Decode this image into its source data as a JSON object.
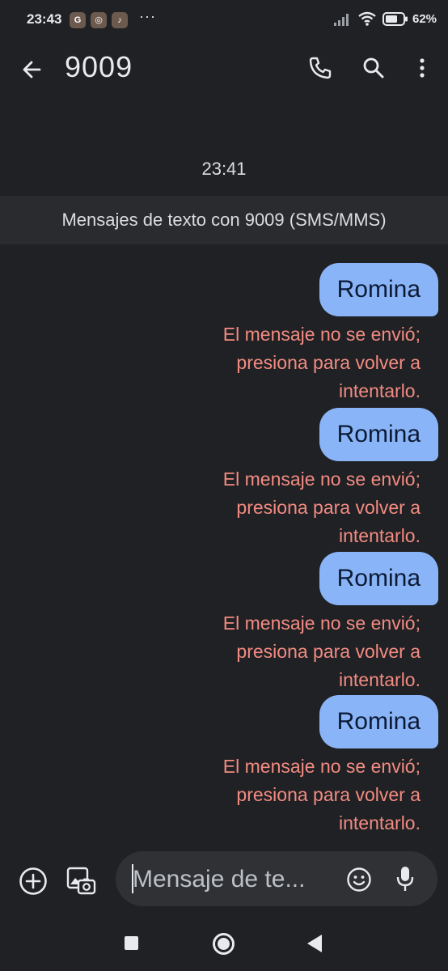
{
  "status_bar": {
    "time": "23:43",
    "app_icons": [
      {
        "name": "google-notification-icon",
        "glyph": "G"
      },
      {
        "name": "instagram-notification-icon",
        "glyph": "◎"
      },
      {
        "name": "tiktok-notification-icon",
        "glyph": "♪"
      }
    ],
    "more_indicator": "···",
    "battery_percent": "62%"
  },
  "app_bar": {
    "title": "9009",
    "icons": [
      "back-arrow-icon",
      "phone-icon",
      "search-icon",
      "more-vert-icon"
    ]
  },
  "conversation": {
    "timestamp": "23:41",
    "banner": "Mensajes de texto con 9009 (SMS/MMS)",
    "messages": [
      {
        "text": "Romina",
        "status_line1": "El mensaje no se envió;",
        "status_line2": "presiona para volver a",
        "status_line3": "intentarlo."
      },
      {
        "text": "Romina",
        "status_line1": "El mensaje no se envió;",
        "status_line2": "presiona para volver a",
        "status_line3": "intentarlo."
      },
      {
        "text": "Romina",
        "status_line1": "El mensaje no se envió;",
        "status_line2": "presiona para volver a",
        "status_line3": "intentarlo."
      },
      {
        "text": "Romina",
        "status_line1": "El mensaje no se envió;",
        "status_line2": "presiona para volver a",
        "status_line3": "intentarlo."
      }
    ]
  },
  "compose": {
    "placeholder": "Mensaje de te...",
    "icons": [
      "add-icon",
      "gallery-icon",
      "emoji-icon",
      "mic-icon"
    ]
  },
  "colors": {
    "background": "#202124",
    "bubble": "#8ab4f8",
    "error_text": "#f28b82",
    "banner": "#2a2b2e",
    "compose_pill": "#303134"
  }
}
